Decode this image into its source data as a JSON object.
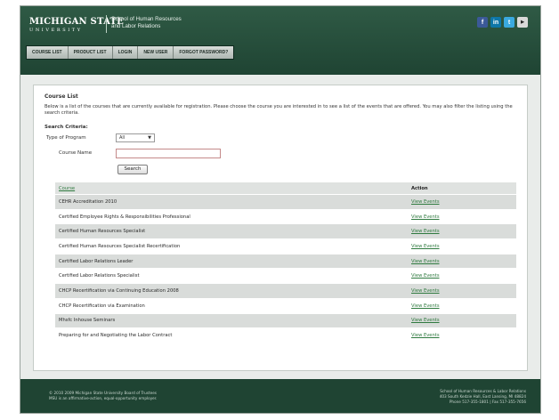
{
  "header": {
    "university_line1": "MICHIGAN STATE",
    "university_line2": "UNIVERSITY",
    "school_line1": "School of Human Resources",
    "school_line2": "and Labor Relations",
    "social": [
      "f",
      "in",
      "t",
      "▶"
    ]
  },
  "nav": [
    "COURSE LIST",
    "PRODUCT LIST",
    "LOGIN",
    "NEW USER",
    "FORGOT PASSWORD?"
  ],
  "main": {
    "title": "Course List",
    "intro": "Below is a list of the courses that are currently available for registration. Please choose the course you are interested in to see a list of the events that are offered. You may also filter the listing using the search criteria.",
    "search_criteria": "Search Criteria:",
    "type_label": "Type of Program",
    "type_value": "All",
    "course_name_label": "Course Name",
    "course_name_value": "",
    "search_button": "Search"
  },
  "table": {
    "headers": [
      "Course",
      "Action"
    ],
    "rows": [
      {
        "course": "CEHR Accreditation 2010",
        "action": "View Events"
      },
      {
        "course": "Certified Employee Rights & Responsibilities Professional",
        "action": "View Events"
      },
      {
        "course": "Certified Human Resources Specialist",
        "action": "View Events"
      },
      {
        "course": "Certified Human Resources Specialist Recertification",
        "action": "View Events"
      },
      {
        "course": "Certified Labor Relations Leader",
        "action": "View Events"
      },
      {
        "course": "Certified Labor Relations Specialist",
        "action": "View Events"
      },
      {
        "course": "CHCP Recertification via Continuing Education 2008",
        "action": "View Events"
      },
      {
        "course": "CHCP Recertification via Examination",
        "action": "View Events"
      },
      {
        "course": "Mhsfc Inhouse Seminars",
        "action": "View Events"
      },
      {
        "course": "Preparing for and Negotiating the Labor Contract",
        "action": "View Events"
      }
    ]
  },
  "footer": {
    "left_line1": "© 2010 2009 Michigan State University Board of Trustees",
    "left_line2": "MSU is an affirmative-action, equal-opportunity employer.",
    "right_line1": "School of Human Resources & Labor Relations",
    "right_line2": "403 South Kedzie Hall, East Lansing, MI 48824",
    "right_line3": "Phone 517-355-1801 | Fax 517-355-7656"
  }
}
